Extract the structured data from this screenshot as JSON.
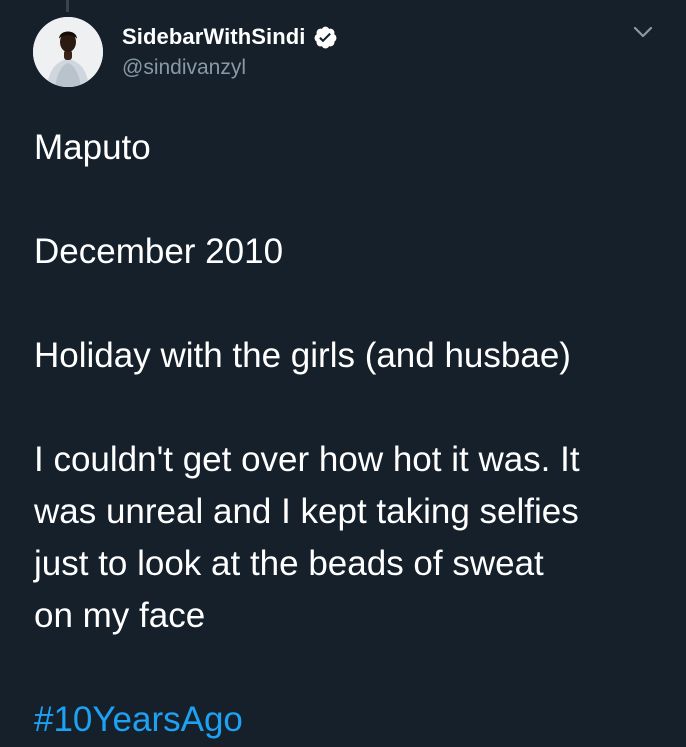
{
  "author": {
    "display_name": "SidebarWithSindi",
    "handle": "@sindivanzyl",
    "verified": true,
    "avatar_icon": "profile-photo"
  },
  "tweet": {
    "lines": [
      "Maputo",
      "December 2010",
      "Holiday with the girls (and husbae)",
      "I couldn't get over how hot it was. It",
      "was unreal and I kept taking selfies",
      "just to look at the beads of sweat",
      "on my face"
    ],
    "hashtag": "#10YearsAgo"
  },
  "icons": {
    "verified": "verified-badge-icon",
    "menu": "chevron-down-icon"
  },
  "colors": {
    "background": "#15202b",
    "text": "#ffffff",
    "secondary_text": "#8899a6",
    "link": "#1da1f2"
  }
}
